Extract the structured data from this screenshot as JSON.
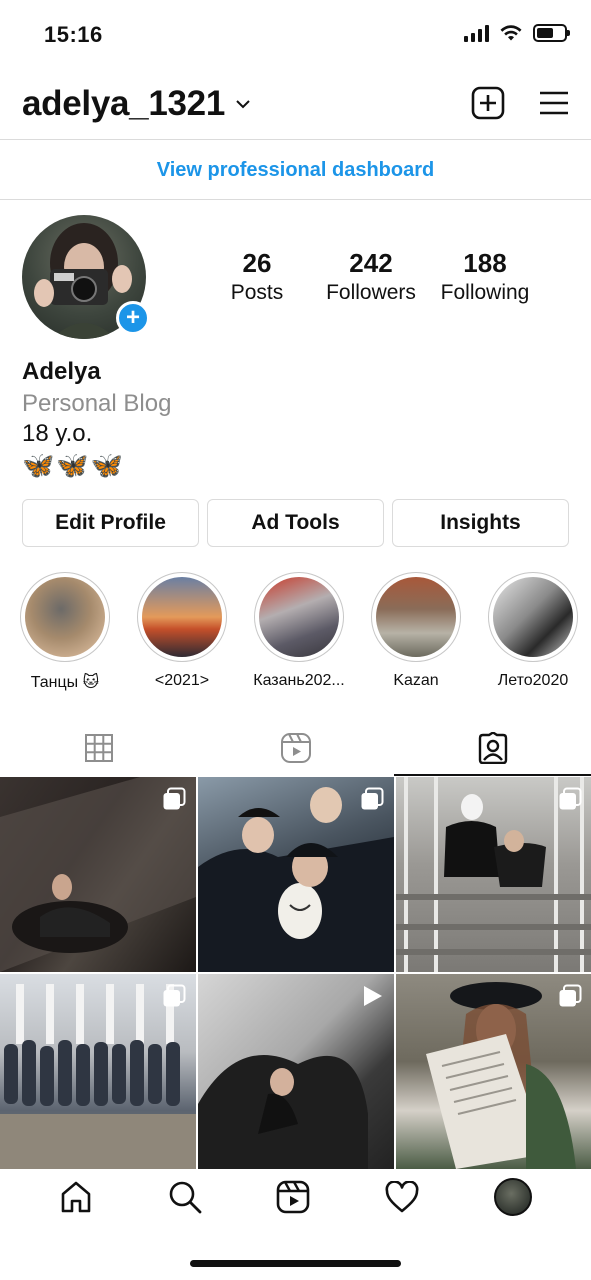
{
  "status": {
    "time": "15:16",
    "battery_level": 0.6
  },
  "header": {
    "username": "adelya_1321"
  },
  "dashboard": {
    "label": "View professional dashboard"
  },
  "profile": {
    "stats": [
      {
        "value": "26",
        "label": "Posts"
      },
      {
        "value": "242",
        "label": "Followers"
      },
      {
        "value": "188",
        "label": "Following"
      }
    ],
    "name": "Adelya",
    "category": "Personal Blog",
    "bio_line": "18 y.o.",
    "bio_emoji": "🦋🦋🦋"
  },
  "actions": {
    "edit": "Edit Profile",
    "ad_tools": "Ad Tools",
    "insights": "Insights"
  },
  "highlights": [
    {
      "label": "Танцы 🐱",
      "color": "#9c7a5c"
    },
    {
      "label": "<2021>",
      "color": "#d7874a"
    },
    {
      "label": "Казань202...",
      "color": "#8a6f6e"
    },
    {
      "label": "Kazan",
      "color": "#8b6c58"
    },
    {
      "label": "Лето2020",
      "color": "#4a4a4a"
    }
  ],
  "tabs": [
    "grid-icon",
    "reels-icon",
    "tagged-icon"
  ],
  "accent_color": "#1c95e8"
}
